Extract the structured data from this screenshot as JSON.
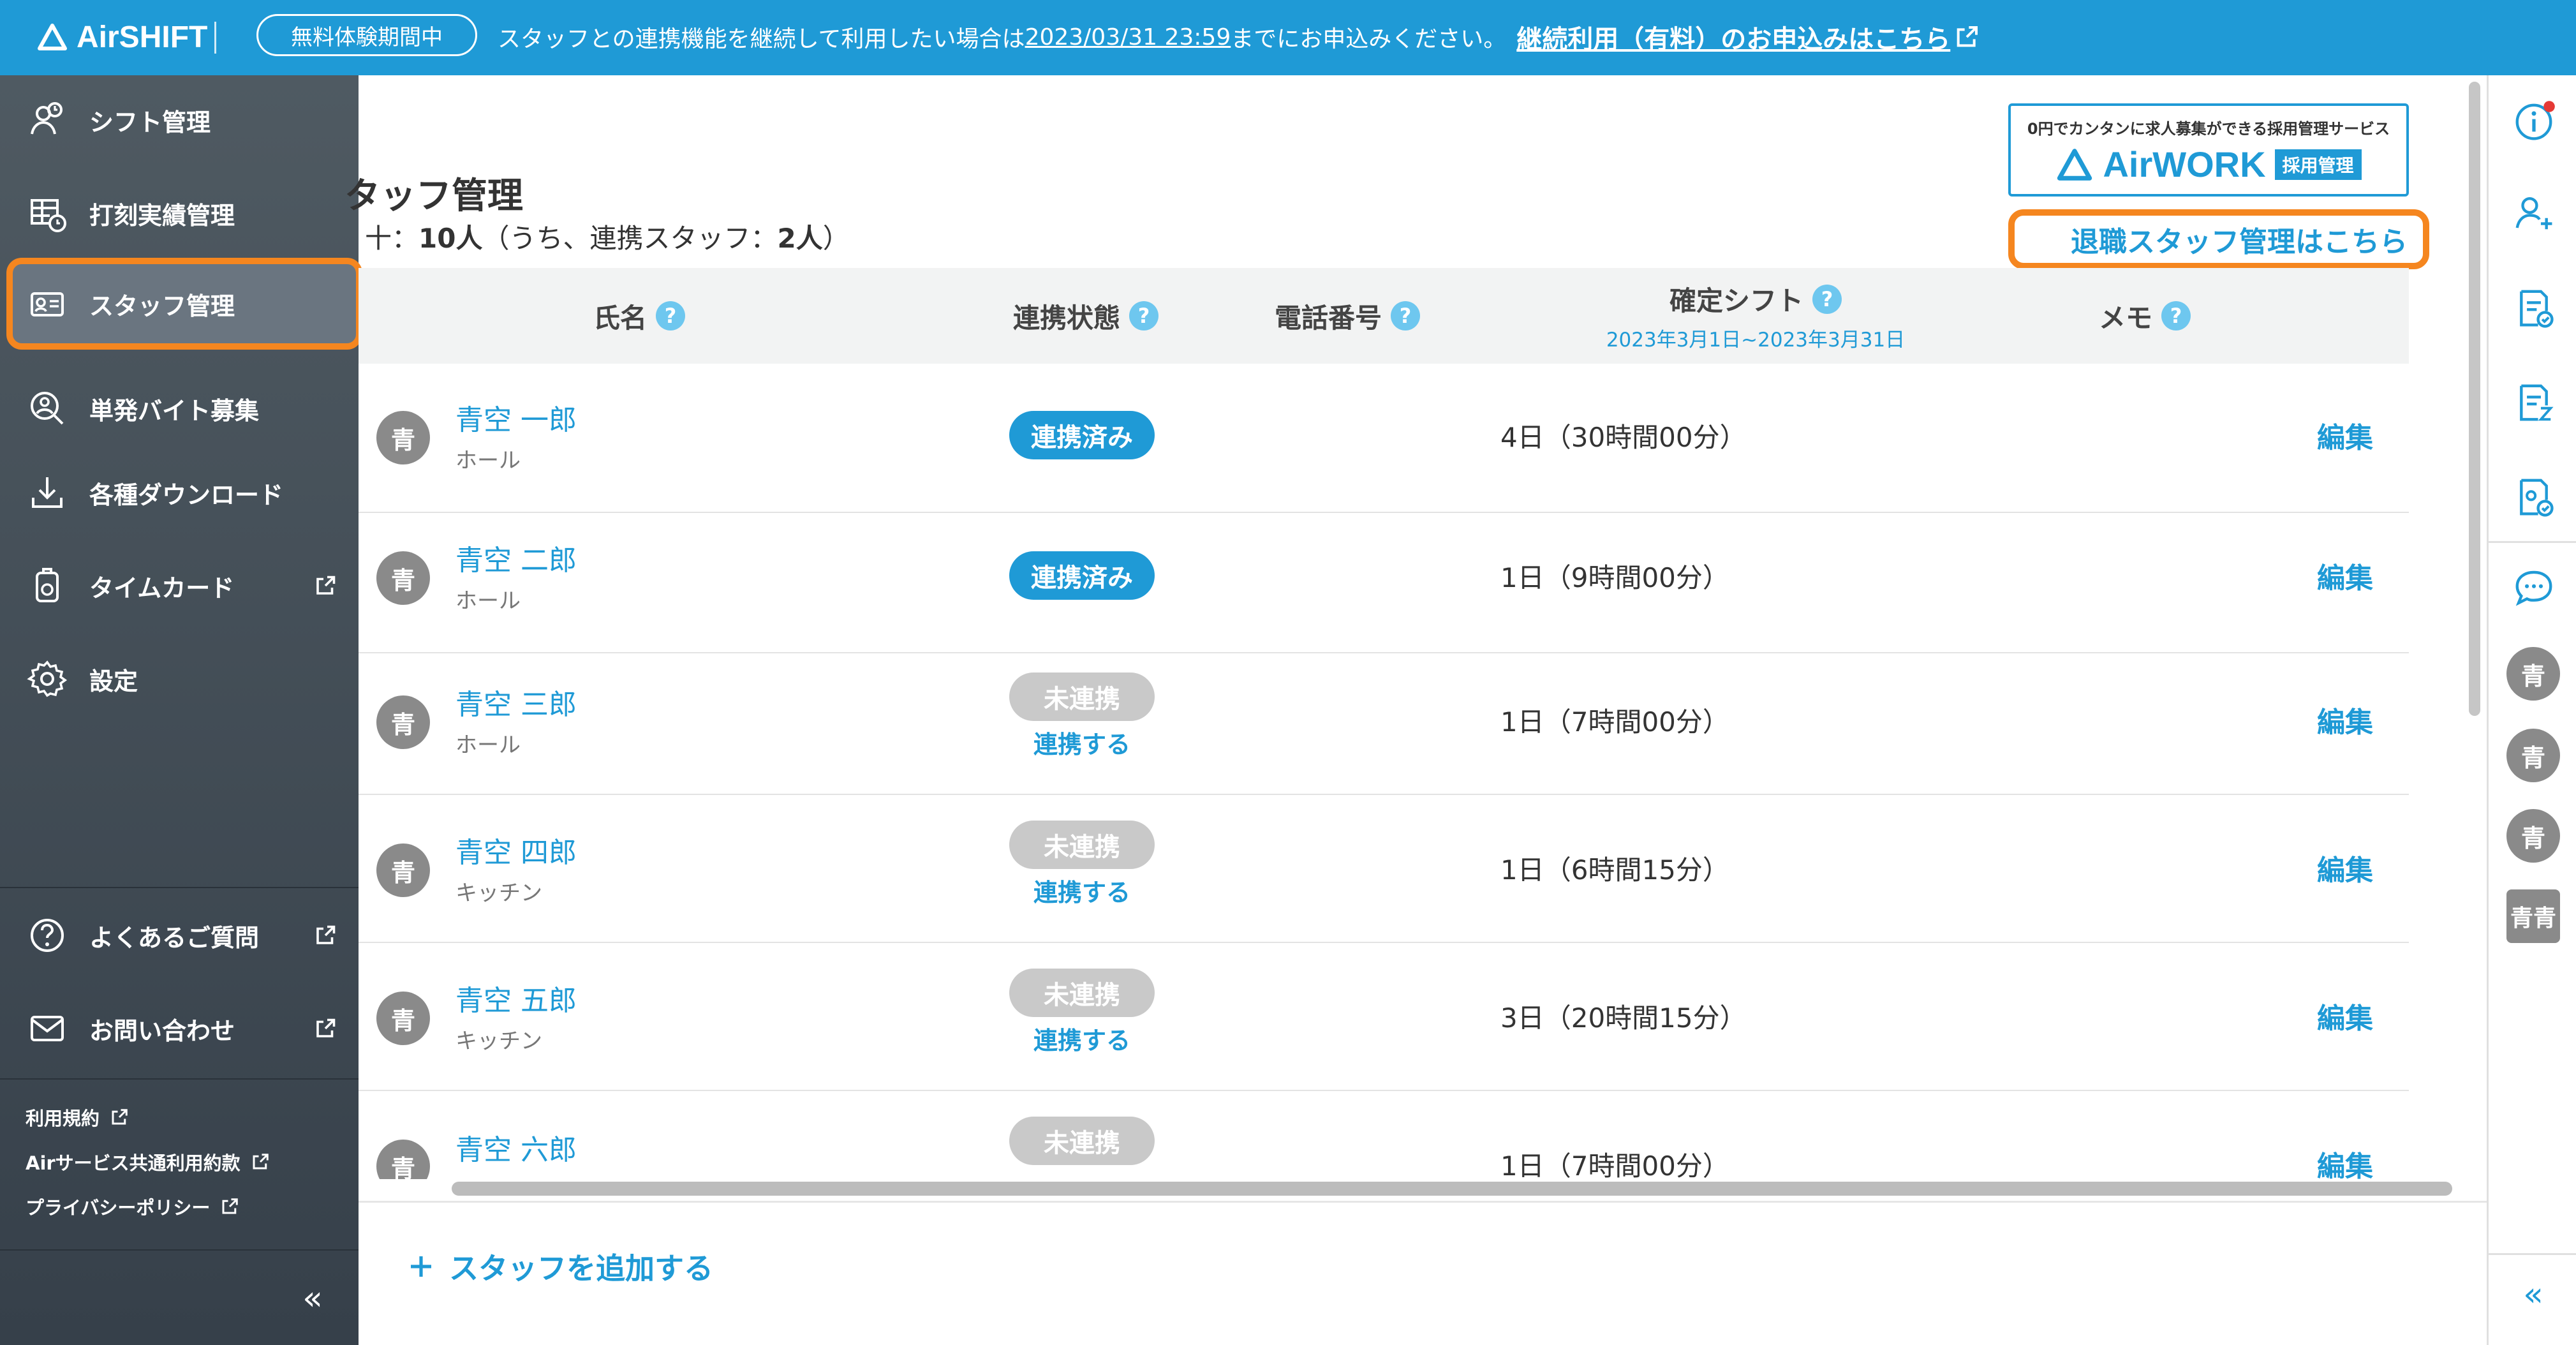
{
  "banner": {
    "logo_text": "AirSHIFT",
    "trial_badge": "無料体験期間中",
    "message_before": "スタッフとの連携機能を継続して利用したい場合は",
    "deadline": "2023/03/31 23:59",
    "message_after": "までにお申込みください。",
    "link_label": "継続利用（有料）のお申込みはこちら"
  },
  "sidebar": {
    "items": [
      {
        "label": "シフト管理"
      },
      {
        "label": "打刻実績管理"
      },
      {
        "label": "スタッフ管理"
      },
      {
        "label": "単発バイト募集"
      },
      {
        "label": "各種ダウンロード"
      },
      {
        "label": "タイムカード"
      },
      {
        "label": "設定"
      }
    ],
    "help": [
      {
        "label": "よくあるご質問"
      },
      {
        "label": "お問い合わせ"
      }
    ],
    "footer_links": [
      {
        "label": "利用規約"
      },
      {
        "label": "Airサービス共通利用約款"
      },
      {
        "label": "プライバシーポリシー"
      }
    ],
    "collapse": "«"
  },
  "page": {
    "title": "タッフ管理",
    "count_prefix": "十：",
    "count_total": "10人",
    "count_mid": "（うち、連携スタッフ：",
    "count_linked": "2人",
    "count_suffix": "）"
  },
  "airwork": {
    "tagline": "0円でカンタンに求人募集ができる採用管理サービス",
    "brand": "AirWORK",
    "tag": "採用管理"
  },
  "retired_link": "退職スタッフ管理はこちら",
  "table": {
    "headers": {
      "name": "氏名",
      "status": "連携状態",
      "phone": "電話番号",
      "shift": "確定シフト",
      "shift_range": "2023年3月1日~2023年3月31日",
      "memo": "メモ"
    },
    "rows": [
      {
        "avatar": "青",
        "name": "青空 一郎",
        "position": "ホール",
        "status": "連携済み",
        "linked": true,
        "link_action": "",
        "shift": "4日（30時間00分）",
        "edit": "編集"
      },
      {
        "avatar": "青",
        "name": "青空 二郎",
        "position": "ホール",
        "status": "連携済み",
        "linked": true,
        "link_action": "",
        "shift": "1日（9時間00分）",
        "edit": "編集"
      },
      {
        "avatar": "青",
        "name": "青空 三郎",
        "position": "ホール",
        "status": "未連携",
        "linked": false,
        "link_action": "連携する",
        "shift": "1日（7時間00分）",
        "edit": "編集"
      },
      {
        "avatar": "青",
        "name": "青空 四郎",
        "position": "キッチン",
        "status": "未連携",
        "linked": false,
        "link_action": "連携する",
        "shift": "1日（6時間15分）",
        "edit": "編集"
      },
      {
        "avatar": "青",
        "name": "青空 五郎",
        "position": "キッチン",
        "status": "未連携",
        "linked": false,
        "link_action": "連携する",
        "shift": "3日（20時間15分）",
        "edit": "編集"
      },
      {
        "avatar": "青",
        "name": "青空 六郎",
        "position": "",
        "status": "未連携",
        "linked": false,
        "link_action": "",
        "shift": "1日（7時間00分）",
        "edit": "編集"
      }
    ],
    "qmark": "?"
  },
  "add_staff": "スタッフを追加する",
  "rail": {
    "avatars": [
      "青",
      "青",
      "青",
      "青青"
    ],
    "collapse": "«"
  },
  "colors": {
    "brand": "#1f9ad6",
    "highlight": "#f5861f",
    "sidebar": "#434e57"
  }
}
